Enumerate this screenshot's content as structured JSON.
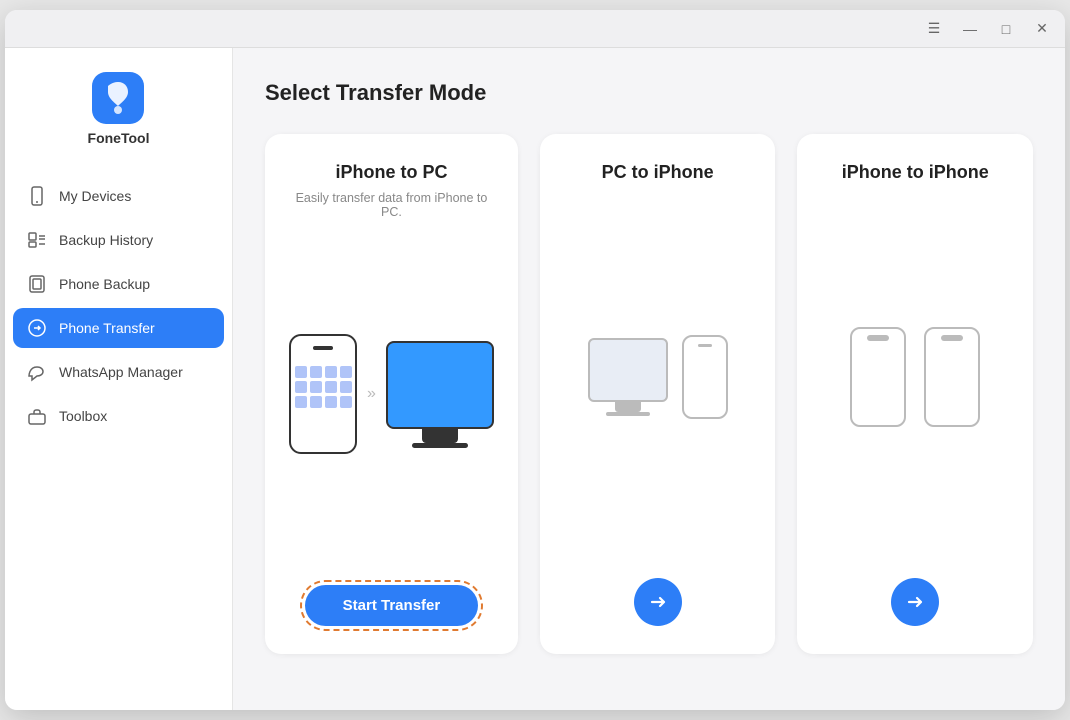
{
  "app": {
    "name": "FoneTool",
    "logo_color": "#2d7ef7"
  },
  "titlebar": {
    "menu_icon": "☰",
    "minimize_icon": "—",
    "maximize_icon": "□",
    "close_icon": "✕"
  },
  "sidebar": {
    "logo_label": "FoneTool",
    "nav_items": [
      {
        "id": "my-devices",
        "label": "My Devices",
        "icon": "phone"
      },
      {
        "id": "backup-history",
        "label": "Backup History",
        "icon": "list"
      },
      {
        "id": "phone-backup",
        "label": "Phone Backup",
        "icon": "backup"
      },
      {
        "id": "phone-transfer",
        "label": "Phone Transfer",
        "icon": "transfer",
        "active": true
      },
      {
        "id": "whatsapp-manager",
        "label": "WhatsApp Manager",
        "icon": "chat"
      },
      {
        "id": "toolbox",
        "label": "Toolbox",
        "icon": "toolbox"
      }
    ]
  },
  "main": {
    "page_title": "Select Transfer Mode",
    "cards": [
      {
        "id": "iphone-to-pc",
        "title": "iPhone to PC",
        "desc": "Easily transfer data from iPhone to PC.",
        "action_label": "Start Transfer",
        "action_type": "button"
      },
      {
        "id": "pc-to-iphone",
        "title": "PC to iPhone",
        "desc": "",
        "action_type": "arrow"
      },
      {
        "id": "iphone-to-iphone",
        "title": "iPhone to iPhone",
        "desc": "",
        "action_type": "arrow"
      }
    ]
  }
}
